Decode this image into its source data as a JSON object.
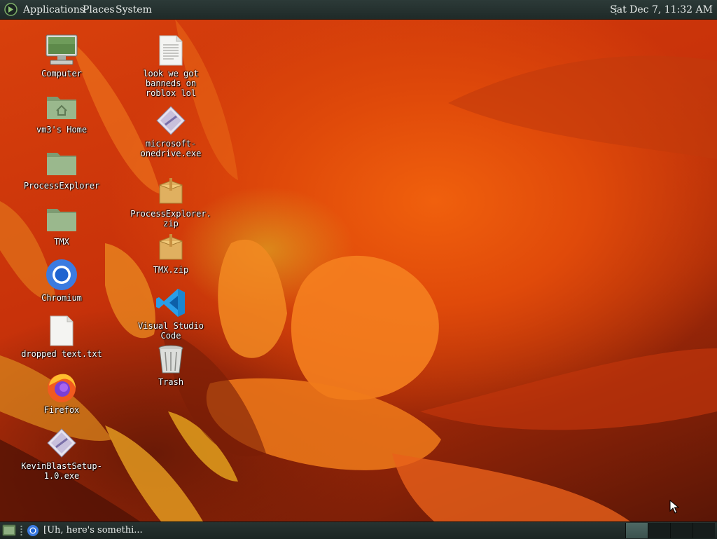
{
  "top_panel": {
    "menus": {
      "applications": "Applications",
      "places": "Places",
      "system": "System"
    },
    "clock": "Sat Dec  7, 11:32 AM"
  },
  "desktop": {
    "icons": {
      "computer": "Computer",
      "home": "vm3's Home",
      "process_explorer_folder": "ProcessExplorer",
      "tmx_folder": "TMX",
      "chromium": "Chromium",
      "dropped_text": "dropped text.txt",
      "firefox": "Firefox",
      "kevinblast": "KevinBlastSetup-\n1.0.exe",
      "look_we_got": "look we got\nbanneds on\nroblox lol",
      "onedrive": "microsoft-\nonedrive.exe",
      "process_explorer_zip": "ProcessExplorer.\nzip",
      "tmx_zip": "TMX.zip",
      "vscode": "Visual Studio\nCode",
      "trash": "Trash"
    }
  },
  "bottom_panel": {
    "task_label": "[Uh, here's somethi...",
    "workspace_count": 4,
    "active_workspace": 1
  },
  "colors": {
    "panel_bg": "#1f2a28",
    "folder_green": "#8fae85",
    "chromium_blue": "#3b7be0",
    "vscode_blue": "#2a9ee8"
  }
}
